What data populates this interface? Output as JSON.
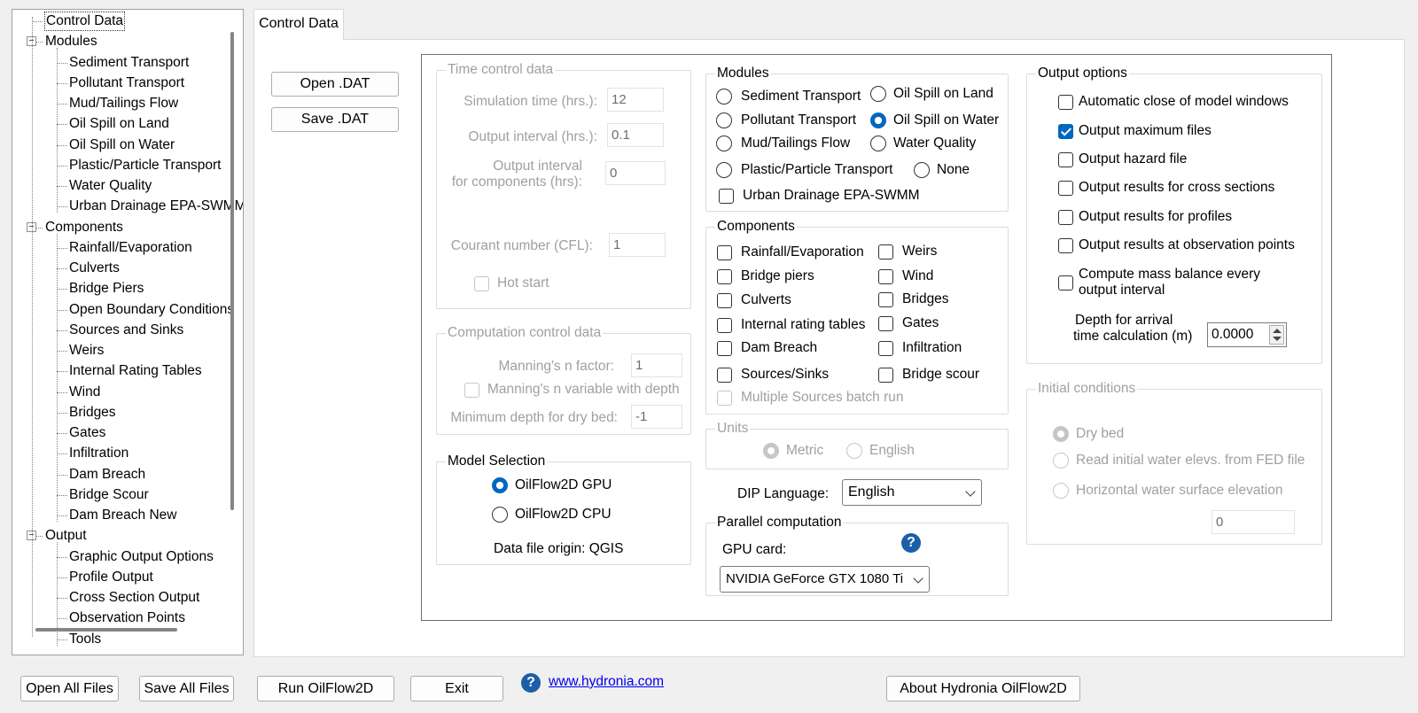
{
  "tree": {
    "items": [
      {
        "label": "Control Data",
        "level": 0,
        "selected": true
      },
      {
        "label": "Modules",
        "level": 0,
        "expander": true
      },
      {
        "label": "Sediment Transport",
        "level": 1
      },
      {
        "label": "Pollutant Transport",
        "level": 1
      },
      {
        "label": "Mud/Tailings Flow",
        "level": 1
      },
      {
        "label": "Oil Spill on Land",
        "level": 1
      },
      {
        "label": "Oil Spill on Water",
        "level": 1
      },
      {
        "label": "Plastic/Particle Transport",
        "level": 1
      },
      {
        "label": "Water Quality",
        "level": 1
      },
      {
        "label": "Urban Drainage EPA-SWMM",
        "level": 1
      },
      {
        "label": "Components",
        "level": 0,
        "expander": true
      },
      {
        "label": "Rainfall/Evaporation",
        "level": 1
      },
      {
        "label": "Culverts",
        "level": 1
      },
      {
        "label": "Bridge Piers",
        "level": 1
      },
      {
        "label": "Open Boundary Conditions",
        "level": 1
      },
      {
        "label": "Sources and Sinks",
        "level": 1
      },
      {
        "label": "Weirs",
        "level": 1
      },
      {
        "label": "Internal Rating Tables",
        "level": 1
      },
      {
        "label": "Wind",
        "level": 1
      },
      {
        "label": "Bridges",
        "level": 1
      },
      {
        "label": "Gates",
        "level": 1
      },
      {
        "label": "Infiltration",
        "level": 1
      },
      {
        "label": "Dam Breach",
        "level": 1
      },
      {
        "label": "Bridge Scour",
        "level": 1
      },
      {
        "label": "Dam Breach New",
        "level": 1
      },
      {
        "label": "Output",
        "level": 0,
        "expander": true
      },
      {
        "label": "Graphic Output Options",
        "level": 1
      },
      {
        "label": "Profile Output",
        "level": 1
      },
      {
        "label": "Cross Section Output",
        "level": 1
      },
      {
        "label": "Observation Points",
        "level": 1
      },
      {
        "label": "Tools",
        "level": 1
      }
    ]
  },
  "tab": {
    "label": "Control Data"
  },
  "file_buttons": {
    "open": "Open .DAT",
    "save": "Save .DAT"
  },
  "time_control": {
    "title": "Time control data",
    "sim_time_label": "Simulation time (hrs.):",
    "sim_time": "12",
    "out_int_label": "Output interval (hrs.):",
    "out_int": "0.1",
    "out_comp_label1": "Output interval",
    "out_comp_label2": "for components (hrs):",
    "out_comp": "0",
    "courant_label": "Courant number (CFL):",
    "courant": "1",
    "hot_start": "Hot start"
  },
  "computation": {
    "title": "Computation control data",
    "mannings_label": "Manning's n factor:",
    "mannings": "1",
    "mannings_var": "Manning's n variable with depth",
    "min_depth_label": "Minimum depth for dry bed:",
    "min_depth": "-1"
  },
  "model_selection": {
    "title": "Model Selection",
    "gpu": "OilFlow2D GPU",
    "cpu": "OilFlow2D CPU",
    "origin": "Data file origin: QGIS"
  },
  "modules": {
    "title": "Modules",
    "sediment": "Sediment Transport",
    "oil_land": "Oil Spill on Land",
    "pollutant": "Pollutant Transport",
    "oil_water": "Oil Spill on Water",
    "mud": "Mud/Tailings Flow",
    "water_quality": "Water Quality",
    "plastic": "Plastic/Particle Transport",
    "none": "None",
    "urban": "Urban Drainage EPA-SWMM"
  },
  "components": {
    "title": "Components",
    "rainfall": "Rainfall/Evaporation",
    "weirs": "Weirs",
    "bridge_piers": "Bridge piers",
    "wind": "Wind",
    "culverts": "Culverts",
    "bridges": "Bridges",
    "rating": "Internal rating tables",
    "gates": "Gates",
    "dam": "Dam Breach",
    "infiltration": "Infiltration",
    "sources": "Sources/Sinks",
    "scour": "Bridge scour",
    "batch": "Multiple Sources batch run"
  },
  "units": {
    "title": "Units",
    "metric": "Metric",
    "english": "English"
  },
  "dip": {
    "label": "DIP Language:",
    "value": "English"
  },
  "parallel": {
    "title": "Parallel computation",
    "gpu_label": "GPU card:",
    "gpu_value": "NVIDIA GeForce GTX 1080 Ti",
    "help": "?"
  },
  "output_options": {
    "title": "Output options",
    "auto_close": "Automatic close of model windows",
    "max_files": "Output maximum files",
    "hazard": "Output hazard file",
    "cross": "Output results for cross sections",
    "profiles": "Output results for profiles",
    "obs": "Output results at observation points",
    "mass1": "Compute mass balance every",
    "mass2": "output interval",
    "arrival1": "Depth for arrival",
    "arrival2": "time calculation (m)",
    "arrival_value": "0.0000"
  },
  "initial": {
    "title": "Initial conditions",
    "dry": "Dry bed",
    "fed": "Read initial water elevs. from FED file",
    "horiz": "Horizontal water surface elevation",
    "horiz_value": "0"
  },
  "bottom": {
    "open_all": "Open All Files",
    "save_all": "Save All Files",
    "run": "Run OilFlow2D",
    "exit": "Exit",
    "help": "?",
    "link": "www.hydronia.com",
    "about": "About Hydronia OilFlow2D"
  }
}
